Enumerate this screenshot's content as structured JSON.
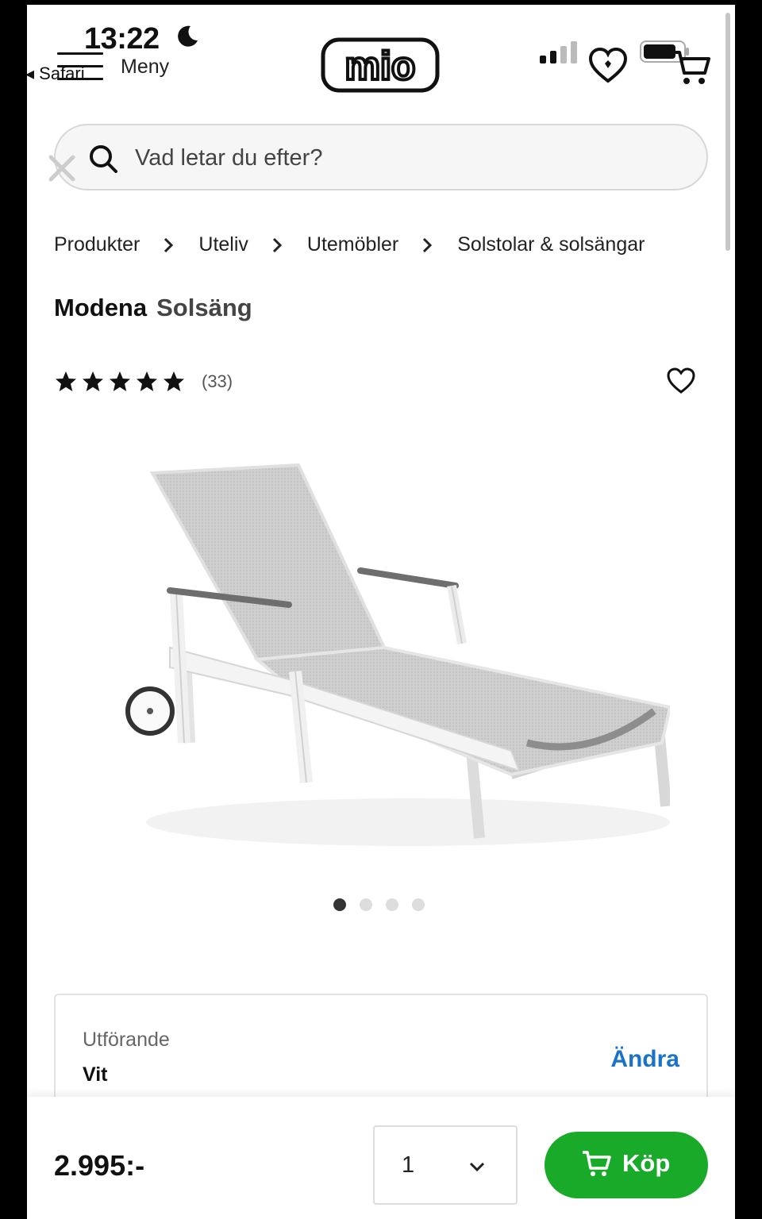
{
  "status_bar": {
    "time": "13:22",
    "back_app": "Safari"
  },
  "header": {
    "menu_label": "Meny",
    "logo_text": "mio"
  },
  "search": {
    "placeholder": "Vad letar du efter?"
  },
  "breadcrumb": [
    "Produkter",
    "Uteliv",
    "Utemöbler",
    "Solstolar & solsängar"
  ],
  "product": {
    "brand": "Modena",
    "type": "Solsäng",
    "rating": 5,
    "review_count": "(33)",
    "image_count": 4,
    "image_active_index": 0
  },
  "variant": {
    "label": "Utförande",
    "value": "Vit",
    "change_label": "Ändra"
  },
  "footer": {
    "price": "2.995:-",
    "quantity": "1",
    "buy_label": "Köp"
  },
  "colors": {
    "buy_button": "#1aaa2a",
    "link": "#1b73c7",
    "text": "#222222"
  }
}
